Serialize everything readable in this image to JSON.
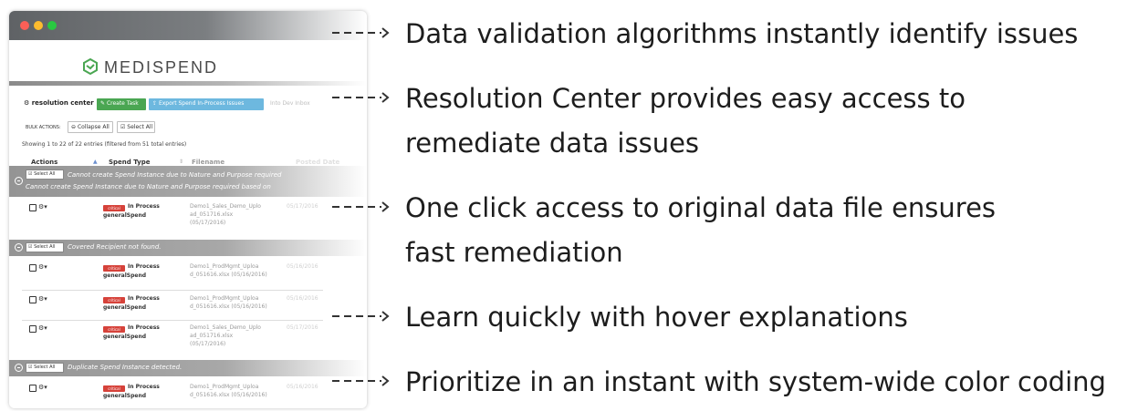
{
  "app": {
    "brand": "MEDISPEND",
    "brand_color": "#4aa652"
  },
  "toolbar": {
    "title": "resolution center",
    "create_task": "Create Task",
    "export_spend": "Export Spend In-Process Issues",
    "ghost": "Into Dev Inbox"
  },
  "bulk": {
    "label": "BULK ACTIONS:",
    "collapse_all": "Collapse All",
    "select_all": "Select All"
  },
  "showing": "Showing 1 to 22 of 22 entries (filtered from 51 total entries)",
  "table": {
    "headers": {
      "actions": "Actions",
      "spend_type": "Spend Type",
      "filename": "Filename",
      "extra": "Posted Date"
    },
    "groups": [
      {
        "select_label": "Select All",
        "title": "Cannot create Spend Instance due to Nature and Purpose required",
        "subtitle": "Cannot create Spend Instance due to Nature and Purpose required based on"
      },
      {
        "select_label": "Select All",
        "title": "Covered Recipient not found."
      },
      {
        "select_label": "Select All",
        "title": "Duplicate Spend Instance detected."
      }
    ],
    "rows": [
      {
        "badge": "critical",
        "status": "In Process",
        "spend_type": "generalSpend",
        "file_line1": "Demo1_Sales_Demo_Uplo",
        "file_line2": "ad_051716.xlsx",
        "file_line3": "(05/17/2016)",
        "date": "05/17/2016"
      },
      {
        "badge": "critical",
        "status": "In Process",
        "spend_type": "generalSpend",
        "file_line1": "Demo1_ProdMgmt_Uploa",
        "file_line2": "d_051616.xlsx (05/16/2016)",
        "date": "05/16/2016"
      },
      {
        "badge": "critical",
        "status": "In Process",
        "spend_type": "generalSpend",
        "file_line1": "Demo1_ProdMgmt_Uploa",
        "file_line2": "d_051616.xlsx (05/16/2016)",
        "date": "05/16/2016"
      },
      {
        "badge": "critical",
        "status": "In Process",
        "spend_type": "generalSpend",
        "file_line1": "Demo1_Sales_Demo_Uplo",
        "file_line2": "ad_051716.xlsx",
        "file_line3": "(05/17/2016)",
        "date": "05/17/2016"
      },
      {
        "badge": "critical",
        "status": "In Process",
        "spend_type": "generalSpend",
        "file_line1": "Demo1_ProdMgmt_Uploa",
        "file_line2": "d_051616.xlsx (05/16/2016)",
        "date": "05/16/2016"
      }
    ]
  },
  "features": [
    {
      "line1": "Data validation algorithms instantly identify issues"
    },
    {
      "line1": "Resolution Center provides easy access to",
      "line2": "remediate data issues"
    },
    {
      "line1": "One click access to original data file ensures",
      "line2": "fast remediation"
    },
    {
      "line1": "Learn quickly with hover explanations"
    },
    {
      "line1": "Prioritize in an instant with system-wide color coding"
    }
  ]
}
